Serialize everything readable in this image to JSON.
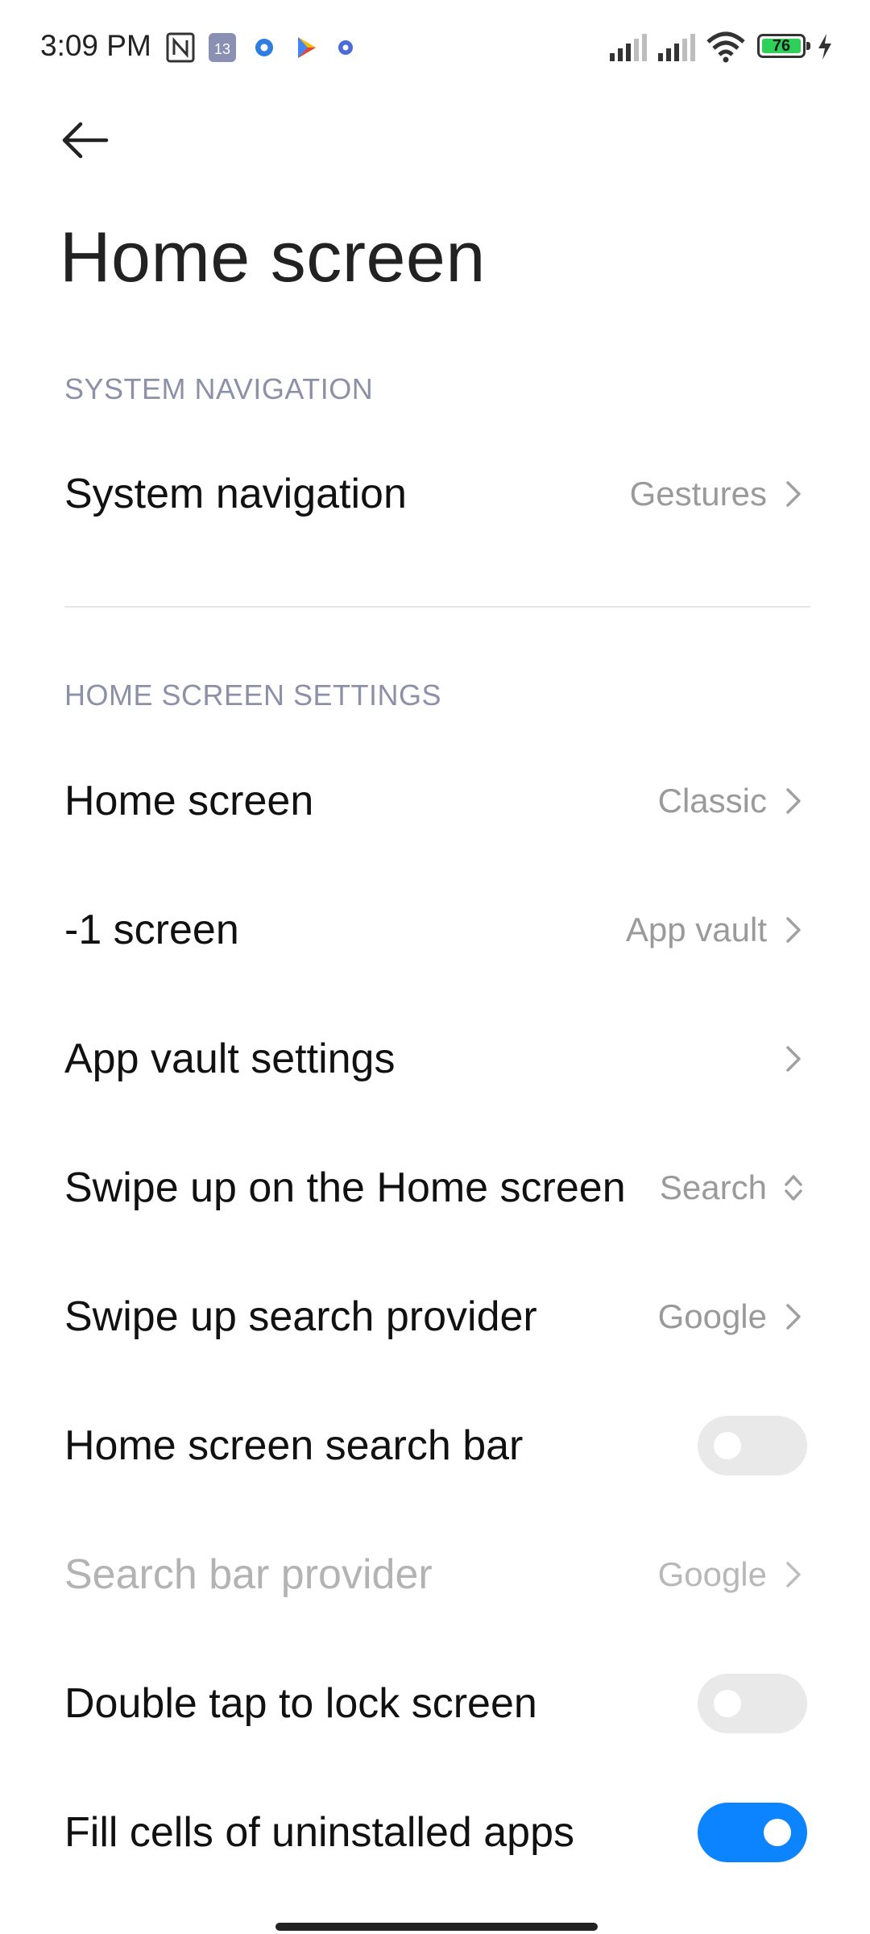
{
  "status_bar": {
    "time": "3:09 PM",
    "battery": "76",
    "icons": [
      "nfc-icon",
      "notification-app-icon",
      "settings-gear-icon",
      "play-store-icon",
      "settings-small-icon",
      "signal-icon",
      "signal-icon-2",
      "wifi-icon",
      "battery-icon",
      "charging-icon"
    ]
  },
  "header": {
    "back_icon": "back-arrow-icon",
    "title": "Home screen"
  },
  "sections": {
    "system_navigation": {
      "header": "SYSTEM NAVIGATION",
      "item_label": "System navigation",
      "item_value": "Gestures"
    },
    "home_screen_settings": {
      "header": "HOME SCREEN SETTINGS",
      "items": [
        {
          "label": "Home screen",
          "value": "Classic"
        },
        {
          "label": "-1 screen",
          "value": "App vault"
        },
        {
          "label": "App vault settings",
          "value": ""
        },
        {
          "label": "Swipe up on the Home screen",
          "value": "Search"
        },
        {
          "label": "Swipe up search provider",
          "value": "Google"
        },
        {
          "label": "Home screen search bar",
          "toggle": false
        },
        {
          "label": "Search bar provider",
          "value": "Google",
          "disabled": true
        },
        {
          "label": "Double tap to lock screen",
          "toggle": false
        },
        {
          "label": "Fill cells of uninstalled apps",
          "toggle": true
        }
      ]
    }
  },
  "colors": {
    "accent": "#0d84ff",
    "section_header": "#8c91a8",
    "value_text": "#9a9a9a"
  }
}
